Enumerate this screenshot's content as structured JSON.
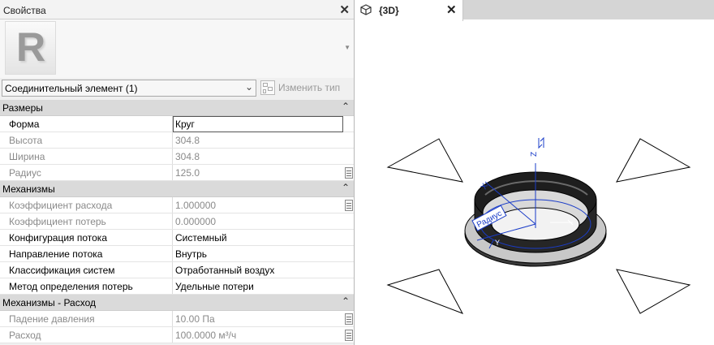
{
  "properties_panel": {
    "title": "Свойства",
    "close_symbol": "✕",
    "logo_letter": "R",
    "type_selector": {
      "value": "Соединительный элемент (1)",
      "edit_type_label": "Изменить тип"
    },
    "groups": [
      {
        "name": "Размеры",
        "rows": [
          {
            "name": "Форма",
            "value": "Круг",
            "readonly": false,
            "active": true
          },
          {
            "name": "Высота",
            "value": "304.8",
            "readonly": true
          },
          {
            "name": "Ширина",
            "value": "304.8",
            "readonly": true
          },
          {
            "name": "Радиус",
            "value": "125.0",
            "readonly": true,
            "has_button": true
          }
        ]
      },
      {
        "name": "Механизмы",
        "rows": [
          {
            "name": "Коэффициент расхода",
            "value": "1.000000",
            "readonly": true,
            "has_button": true
          },
          {
            "name": "Коэффициент потерь",
            "value": "0.000000",
            "readonly": true
          },
          {
            "name": "Конфигурация потока",
            "value": "Системный",
            "readonly": false
          },
          {
            "name": "Направление потока",
            "value": "Внутрь",
            "readonly": false
          },
          {
            "name": "Классификация систем",
            "value": "Отработанный воздух",
            "readonly": false
          },
          {
            "name": "Метод определения потерь",
            "value": "Удельные потери",
            "readonly": false
          }
        ]
      },
      {
        "name": "Механизмы - Расход",
        "rows": [
          {
            "name": "Падение давления",
            "value": "10.00 Па",
            "readonly": true,
            "has_button": true
          },
          {
            "name": "Расход",
            "value": "100.0000 м³/ч",
            "readonly": true,
            "has_button": true
          }
        ]
      }
    ]
  },
  "view_tab": {
    "label": "{3D}",
    "close_symbol": "✕"
  },
  "view_3d": {
    "axis_label_z": "Z",
    "axis_label_x": "X",
    "axis_label_y": "Y",
    "dimension_label": "Радиус",
    "ring_color": "#2a2a2a",
    "axis_color": "#1a3cc8"
  }
}
